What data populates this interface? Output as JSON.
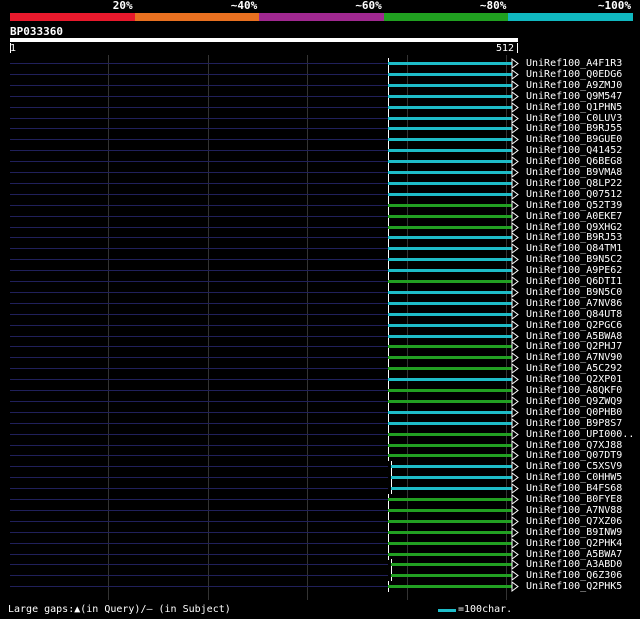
{
  "legend": {
    "labels": [
      "20%",
      "~40%",
      "~60%",
      "~80%",
      "~100%"
    ],
    "colors": [
      "#e8192c",
      "#e87020",
      "#a02890",
      "#20a020",
      "#10b8c0"
    ]
  },
  "query": {
    "id": "BP033360",
    "start": "1",
    "end": "512"
  },
  "hits": [
    {
      "name": "UniRef100_A4F1R3",
      "color": "#1ebcc8"
    },
    {
      "name": "UniRef100_Q0EDG6",
      "color": "#1ebcc8"
    },
    {
      "name": "UniRef100_A9ZMJ0",
      "color": "#1ebcc8"
    },
    {
      "name": "UniRef100_Q9M547",
      "color": "#1ebcc8"
    },
    {
      "name": "UniRef100_Q1PHN5",
      "color": "#1ebcc8"
    },
    {
      "name": "UniRef100_C0LUV3",
      "color": "#1ebcc8"
    },
    {
      "name": "UniRef100_B9RJ55",
      "color": "#1ebcc8"
    },
    {
      "name": "UniRef100_B9GUE0",
      "color": "#1ebcc8"
    },
    {
      "name": "UniRef100_Q41452",
      "color": "#1ebcc8"
    },
    {
      "name": "UniRef100_Q6BEG8",
      "color": "#1ebcc8"
    },
    {
      "name": "UniRef100_B9VMA8",
      "color": "#1ebcc8"
    },
    {
      "name": "UniRef100_Q8LP22",
      "color": "#1ebcc8"
    },
    {
      "name": "UniRef100_Q07512",
      "color": "#1ebcc8"
    },
    {
      "name": "UniRef100_Q52T39",
      "color": "#22a022"
    },
    {
      "name": "UniRef100_A0EKE7",
      "color": "#22a022"
    },
    {
      "name": "UniRef100_Q9XHG2",
      "color": "#22a022"
    },
    {
      "name": "UniRef100_B9RJ53",
      "color": "#1ebcc8"
    },
    {
      "name": "UniRef100_Q84TM1",
      "color": "#1ebcc8"
    },
    {
      "name": "UniRef100_B9N5C2",
      "color": "#1ebcc8"
    },
    {
      "name": "UniRef100_A9PE62",
      "color": "#1ebcc8"
    },
    {
      "name": "UniRef100_Q6DTI1",
      "color": "#22a022"
    },
    {
      "name": "UniRef100_B9N5C0",
      "color": "#1ebcc8"
    },
    {
      "name": "UniRef100_A7NV86",
      "color": "#1ebcc8"
    },
    {
      "name": "UniRef100_Q84UT8",
      "color": "#1ebcc8"
    },
    {
      "name": "UniRef100_Q2PGC6",
      "color": "#1ebcc8"
    },
    {
      "name": "UniRef100_A5BWA8",
      "color": "#1ebcc8"
    },
    {
      "name": "UniRef100_Q2PHJ7",
      "color": "#22a022"
    },
    {
      "name": "UniRef100_A7NV90",
      "color": "#22a022"
    },
    {
      "name": "UniRef100_A5C292",
      "color": "#22a022"
    },
    {
      "name": "UniRef100_Q2XP01",
      "color": "#1ebcc8"
    },
    {
      "name": "UniRef100_A8QKF0",
      "color": "#22a022"
    },
    {
      "name": "UniRef100_Q9ZWQ9",
      "color": "#22a022"
    },
    {
      "name": "UniRef100_Q0PHB0",
      "color": "#1ebcc8"
    },
    {
      "name": "UniRef100_B9P8S7",
      "color": "#1ebcc8"
    },
    {
      "name": "UniRef100_UPI000..",
      "color": "#22a022"
    },
    {
      "name": "UniRef100_Q7XJ88",
      "color": "#22a022"
    },
    {
      "name": "UniRef100_Q07DT9",
      "color": "#22a022"
    },
    {
      "name": "UniRef100_C5XSV9",
      "color": "#1ebcc8"
    },
    {
      "name": "UniRef100_C0HHW5",
      "color": "#1ebcc8"
    },
    {
      "name": "UniRef100_B4FS68",
      "color": "#1ebcc8"
    },
    {
      "name": "UniRef100_B0FYE8",
      "color": "#22a022"
    },
    {
      "name": "UniRef100_A7NV88",
      "color": "#22a022"
    },
    {
      "name": "UniRef100_Q7XZ06",
      "color": "#22a022"
    },
    {
      "name": "UniRef100_B9INW9",
      "color": "#22a022"
    },
    {
      "name": "UniRef100_Q2PHK4",
      "color": "#22a022"
    },
    {
      "name": "UniRef100_A5BWA7",
      "color": "#22a022"
    },
    {
      "name": "UniRef100_A3ABD0",
      "color": "#22a022"
    },
    {
      "name": "UniRef100_Q6Z306",
      "color": "#22a022"
    },
    {
      "name": "UniRef100_Q2PHK5",
      "color": "#22a022"
    }
  ],
  "footer": {
    "large_gaps_text": "Large gaps:▲(in Query)/‒ (in Subject)",
    "scale_text": "=100char."
  }
}
